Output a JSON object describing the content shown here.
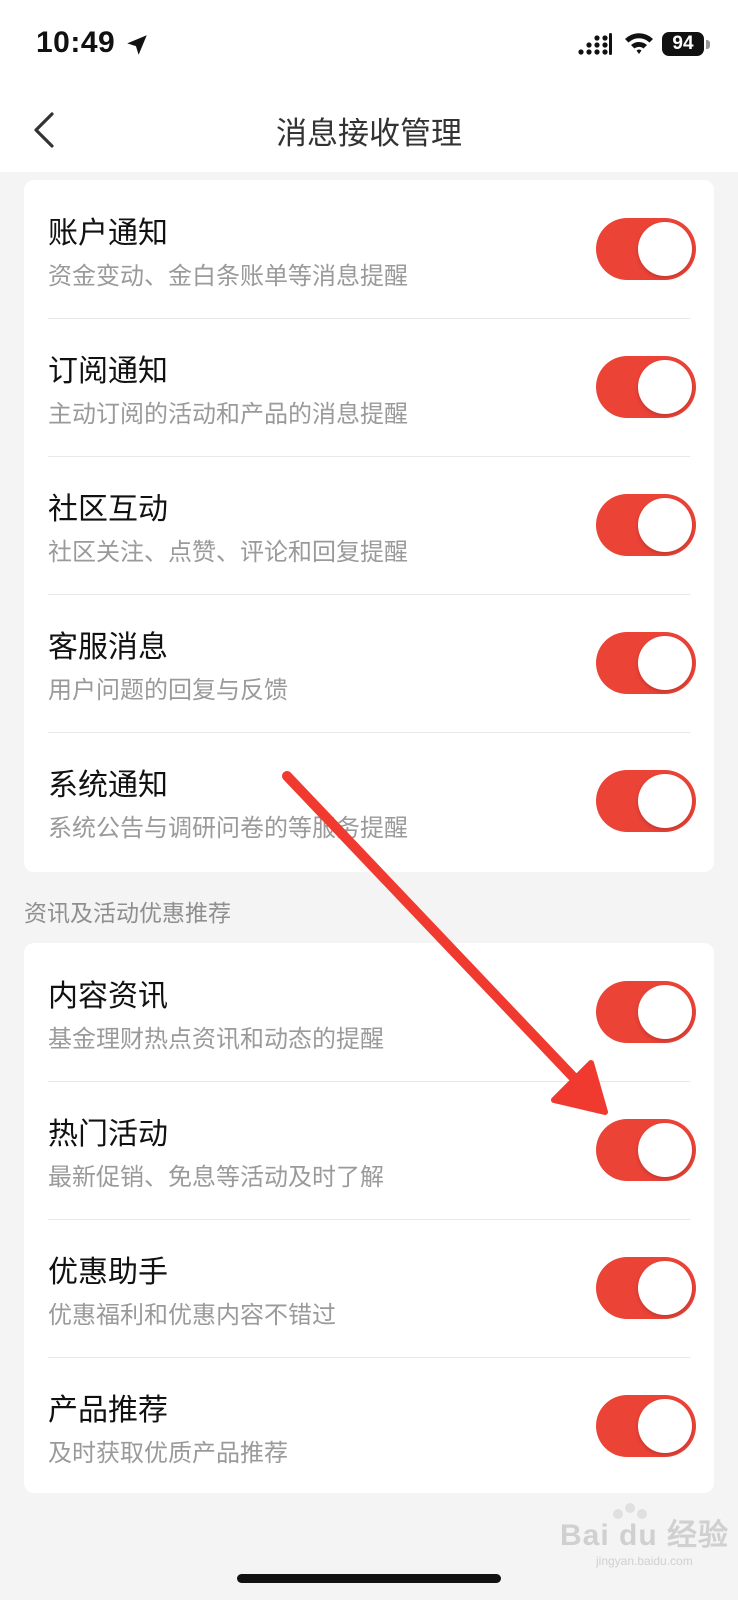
{
  "status_bar": {
    "time": "10:49",
    "battery": "94"
  },
  "header": {
    "title": "消息接收管理"
  },
  "sections": [
    {
      "label": "",
      "items": [
        {
          "title": "账户通知",
          "desc": "资金变动、金白条账单等消息提醒",
          "enabled": true
        },
        {
          "title": "订阅通知",
          "desc": "主动订阅的活动和产品的消息提醒",
          "enabled": true
        },
        {
          "title": "社区互动",
          "desc": "社区关注、点赞、评论和回复提醒",
          "enabled": true
        },
        {
          "title": "客服消息",
          "desc": "用户问题的回复与反馈",
          "enabled": true
        },
        {
          "title": "系统通知",
          "desc": "系统公告与调研问卷的等服务提醒",
          "enabled": true
        }
      ]
    },
    {
      "label": "资讯及活动优惠推荐",
      "items": [
        {
          "title": "内容资讯",
          "desc": "基金理财热点资讯和动态的提醒",
          "enabled": true
        },
        {
          "title": "热门活动",
          "desc": "最新促销、免息等活动及时了解",
          "enabled": true
        },
        {
          "title": "优惠助手",
          "desc": "优惠福利和优惠内容不错过",
          "enabled": true
        },
        {
          "title": "产品推荐",
          "desc": "及时获取优质产品推荐",
          "enabled": true
        }
      ]
    }
  ],
  "colors": {
    "toggle_on": "#ec4337",
    "annotation_arrow": "#f03a2f"
  },
  "watermark": {
    "text": "Bai du 经验",
    "sub": "jingyan.baidu.com"
  }
}
